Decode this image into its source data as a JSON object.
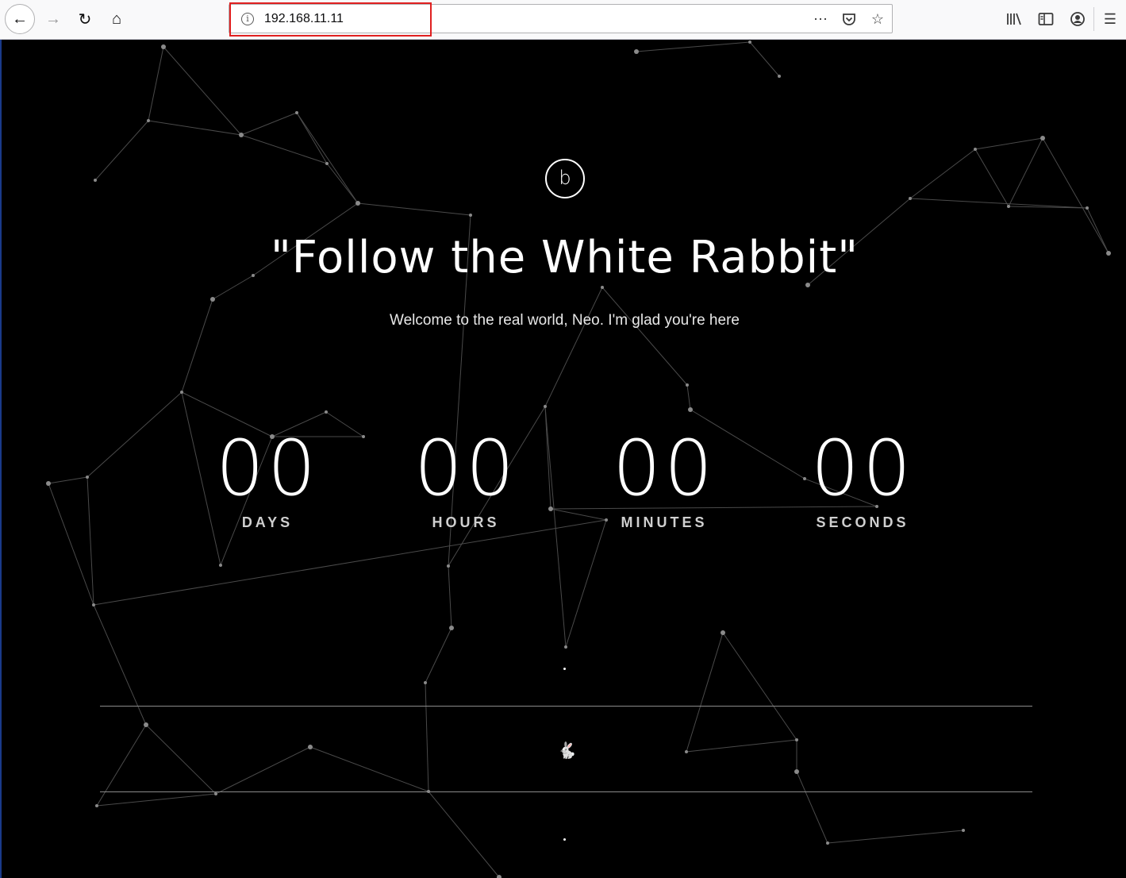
{
  "browser": {
    "url": "192.168.11.11",
    "icons": {
      "back": "back-arrow-icon",
      "forward": "forward-arrow-icon",
      "reload": "reload-icon",
      "home": "home-icon",
      "info": "info-icon",
      "more": "more-actions-icon",
      "pocket": "pocket-icon",
      "bookmark": "bookmark-star-icon",
      "library": "library-icon",
      "sidebar": "sidebar-icon",
      "account": "account-icon",
      "menu": "hamburger-menu-icon"
    }
  },
  "page": {
    "logo_letter": "b",
    "headline": "\"Follow the White Rabbit\"",
    "subtitle": "Welcome to the real world, Neo. I'm glad you're here",
    "countdown": {
      "days": {
        "value": "00",
        "label": "DAYS"
      },
      "hours": {
        "value": "00",
        "label": "HOURS"
      },
      "minutes": {
        "value": "00",
        "label": "MINUTES"
      },
      "seconds": {
        "value": "00",
        "label": "SECONDS"
      }
    },
    "rabbit_icon": "rabbit-icon",
    "colors": {
      "background": "#000000",
      "text": "#ffffff",
      "network_lines": "#4a4a4a",
      "url_highlight": "#e02020"
    }
  }
}
